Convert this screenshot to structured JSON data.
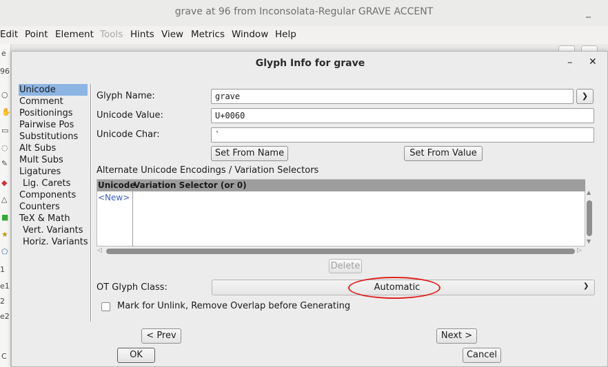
{
  "window": {
    "title": "grave at 96 from Inconsolata-Regular GRAVE ACCENT",
    "minimize_glyph": "_"
  },
  "menubar": [
    {
      "label": "Edit",
      "enabled": true
    },
    {
      "label": "Point",
      "enabled": true
    },
    {
      "label": "Element",
      "enabled": true
    },
    {
      "label": "Tools",
      "enabled": false
    },
    {
      "label": "Hints",
      "enabled": true
    },
    {
      "label": "View",
      "enabled": true
    },
    {
      "label": "Metrics",
      "enabled": true
    },
    {
      "label": "Window",
      "enabled": true
    },
    {
      "label": "Help",
      "enabled": true
    }
  ],
  "background_fragments": [
    "e",
    "96",
    "1",
    "e1",
    "2",
    "e2",
    "C"
  ],
  "dialog": {
    "title": "Glyph Info for grave",
    "minimize_glyph": "–",
    "close_glyph": "✕",
    "sidebar": [
      {
        "label": "Unicode",
        "selected": true,
        "indent": false
      },
      {
        "label": "Comment",
        "selected": false,
        "indent": false
      },
      {
        "label": "Positionings",
        "selected": false,
        "indent": false
      },
      {
        "label": "Pairwise Pos",
        "selected": false,
        "indent": false
      },
      {
        "label": "Substitutions",
        "selected": false,
        "indent": false
      },
      {
        "label": "Alt Subs",
        "selected": false,
        "indent": false
      },
      {
        "label": "Mult Subs",
        "selected": false,
        "indent": false
      },
      {
        "label": "Ligatures",
        "selected": false,
        "indent": false
      },
      {
        "label": "Lig. Carets",
        "selected": false,
        "indent": true
      },
      {
        "label": "Components",
        "selected": false,
        "indent": false
      },
      {
        "label": "Counters",
        "selected": false,
        "indent": false
      },
      {
        "label": "TeX & Math",
        "selected": false,
        "indent": false
      },
      {
        "label": "Vert. Variants",
        "selected": false,
        "indent": true
      },
      {
        "label": "Horiz. Variants",
        "selected": false,
        "indent": true
      }
    ],
    "unicode": {
      "glyph_name_label": "Glyph Name:",
      "glyph_name_value": "grave",
      "unicode_value_label": "Unicode Value:",
      "unicode_value": "U+0060",
      "unicode_char_label": "Unicode Char:",
      "unicode_char": "`",
      "set_from_name": "Set From Name",
      "set_from_value": "Set From Value",
      "alt_encodings_label": "Alternate Unicode Encodings / Variation Selectors",
      "table_columns": [
        "Unicode",
        "Variation Selector (or 0)"
      ],
      "new_row": "<New>",
      "delete": "Delete",
      "ot_class_label": "OT Glyph Class:",
      "ot_class_value": "Automatic",
      "mark_unlink_label": "Mark for Unlink, Remove Overlap before Generating",
      "mark_unlink_checked": false
    },
    "buttons": {
      "prev": "< Prev",
      "next": "Next >",
      "ok": "OK",
      "cancel": "Cancel"
    },
    "annotation_color": "#e0201e",
    "selection_color": "#8db5e3"
  }
}
